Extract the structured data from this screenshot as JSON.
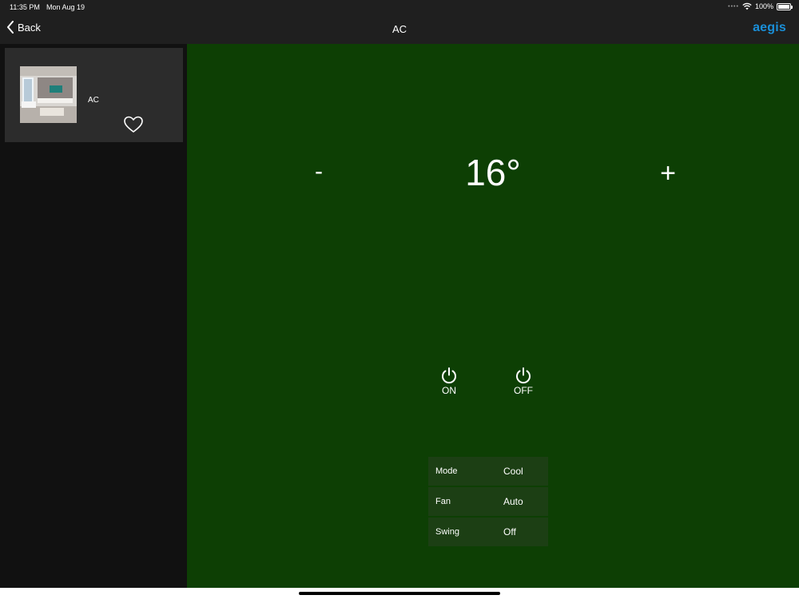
{
  "status_bar": {
    "time": "11:35 PM",
    "date": "Mon Aug 19",
    "battery": "100%",
    "wifi_icon": "wifi-icon",
    "battery_icon": "battery-icon"
  },
  "nav": {
    "back_label": "Back",
    "title": "AC",
    "brand": "aegis",
    "brand_color": "#1a8fd8"
  },
  "sidebar": {
    "devices": [
      {
        "name": "AC",
        "favorite_icon": "heart-outline-icon"
      }
    ]
  },
  "climate": {
    "background_color": "#0d3f04",
    "decrease_label": "-",
    "temperature": "16°",
    "increase_label": "+",
    "power_on_label": "ON",
    "power_off_label": "OFF",
    "settings": [
      {
        "label": "Mode",
        "value": "Cool"
      },
      {
        "label": "Fan",
        "value": "Auto"
      },
      {
        "label": "Swing",
        "value": "Off"
      }
    ]
  }
}
